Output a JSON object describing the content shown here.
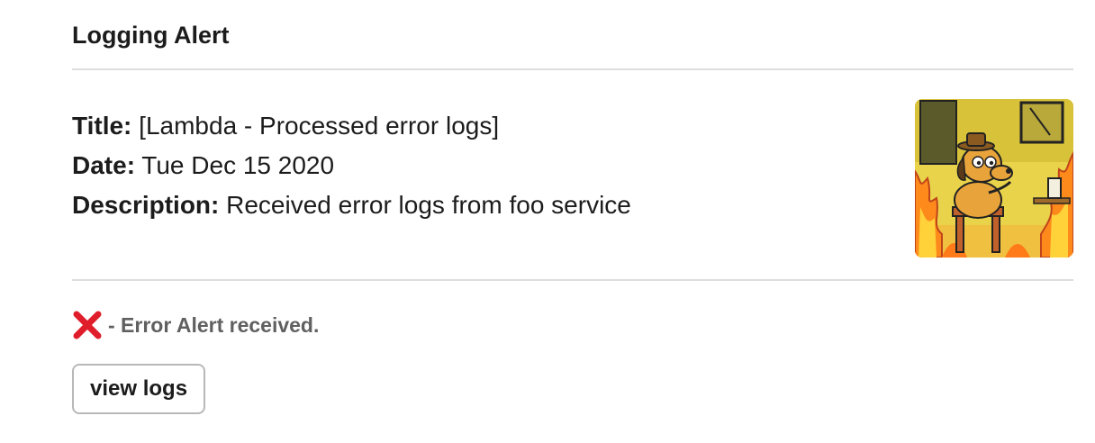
{
  "header": {
    "title": "Logging Alert"
  },
  "details": {
    "title_label": "Title:",
    "title_value": " [Lambda - Processed error logs]",
    "date_label": "Date:",
    "date_value": " Tue Dec 15 2020",
    "description_label": "Description:",
    "description_value": " Received error logs from foo service"
  },
  "thumbnail": {
    "icon": "this-is-fine-dog-image"
  },
  "status": {
    "icon": "red-x-icon",
    "text": " - Error Alert received.",
    "color": "#e01e2b"
  },
  "actions": {
    "view_logs_label": "view logs"
  }
}
